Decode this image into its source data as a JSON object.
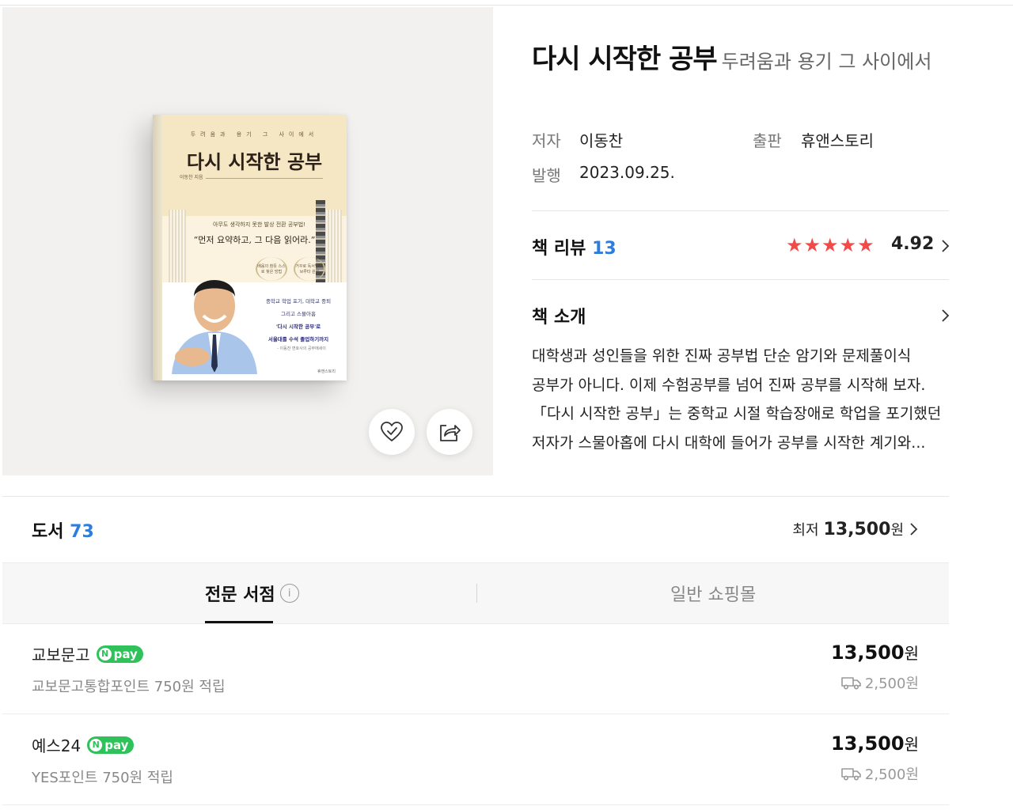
{
  "book": {
    "title": "다시 시작한 공부",
    "subtitle": "두려움과 용기 그 사이에서",
    "author_label": "저자",
    "author": "이동찬",
    "publisher_label": "출판",
    "publisher": "휴앤스토리",
    "date_label": "발행",
    "date": "2023.09.25."
  },
  "cover": {
    "sub": "두려움과 용기 그 사이에서",
    "title": "다시 시작한 공부",
    "author": "이동찬 지음",
    "tag": "아무도 생각하지 못한 발상 전환 공부법!",
    "quote": "“먼저 요약하고, 그 다음 읽어라.”",
    "medal_left": "배움의 참뜻 스스로 찾은 방법",
    "medal_right": "거꾸로 독서법 하브루타 원리",
    "line1": "중학교 학업 포기, 대학교 중퇴",
    "line2": "그리고 스물아홉",
    "line3": "'다시 시작한 공부'로",
    "line4": "서울대를 수석 졸업하기까지",
    "note": "- 이동찬 변호사의 공부에세이",
    "publisher": "휴앤스토리"
  },
  "review": {
    "label": "책 리뷰",
    "count": "13",
    "rating": "4.92",
    "stars": 5
  },
  "intro": {
    "label": "책 소개",
    "lines": [
      "대학생과 성인들을 위한 진짜 공부법 단순 암기와 문제풀이식",
      "공부가 아니다. 이제 수험공부를 넘어 진짜 공부를 시작해 보자.",
      "「다시 시작한 공부」는 중학교 시절 학습장애로 학업을 포기했던",
      "저자가 스물아홉에 다시 대학에 들어가 공부를 시작한 계기와..."
    ]
  },
  "books": {
    "label": "도서",
    "count": "73",
    "lowest_label": "최저",
    "lowest_price": "13,500",
    "lowest_unit": "원"
  },
  "tabs": [
    {
      "label": "전문 서점",
      "active": true
    },
    {
      "label": "일반 쇼핑몰",
      "active": false
    }
  ],
  "stores": [
    {
      "name": "교보문고",
      "pay": "pay",
      "point": "교보문고통합포인트 750원 적립",
      "price": "13,500",
      "unit": "원",
      "shipping": "2,500원"
    },
    {
      "name": "예스24",
      "pay": "pay",
      "point": "YES포인트 750원 적립",
      "price": "13,500",
      "unit": "원",
      "shipping": "2,500원"
    }
  ],
  "icons": {
    "like": "heart-check-icon",
    "share": "share-icon",
    "chevron": "chevron-right-icon",
    "info": "info-icon",
    "truck": "truck-icon"
  },
  "colors": {
    "accent_blue": "#2b7de0",
    "star_red": "#f24949",
    "npay_green": "#2fc25b"
  }
}
